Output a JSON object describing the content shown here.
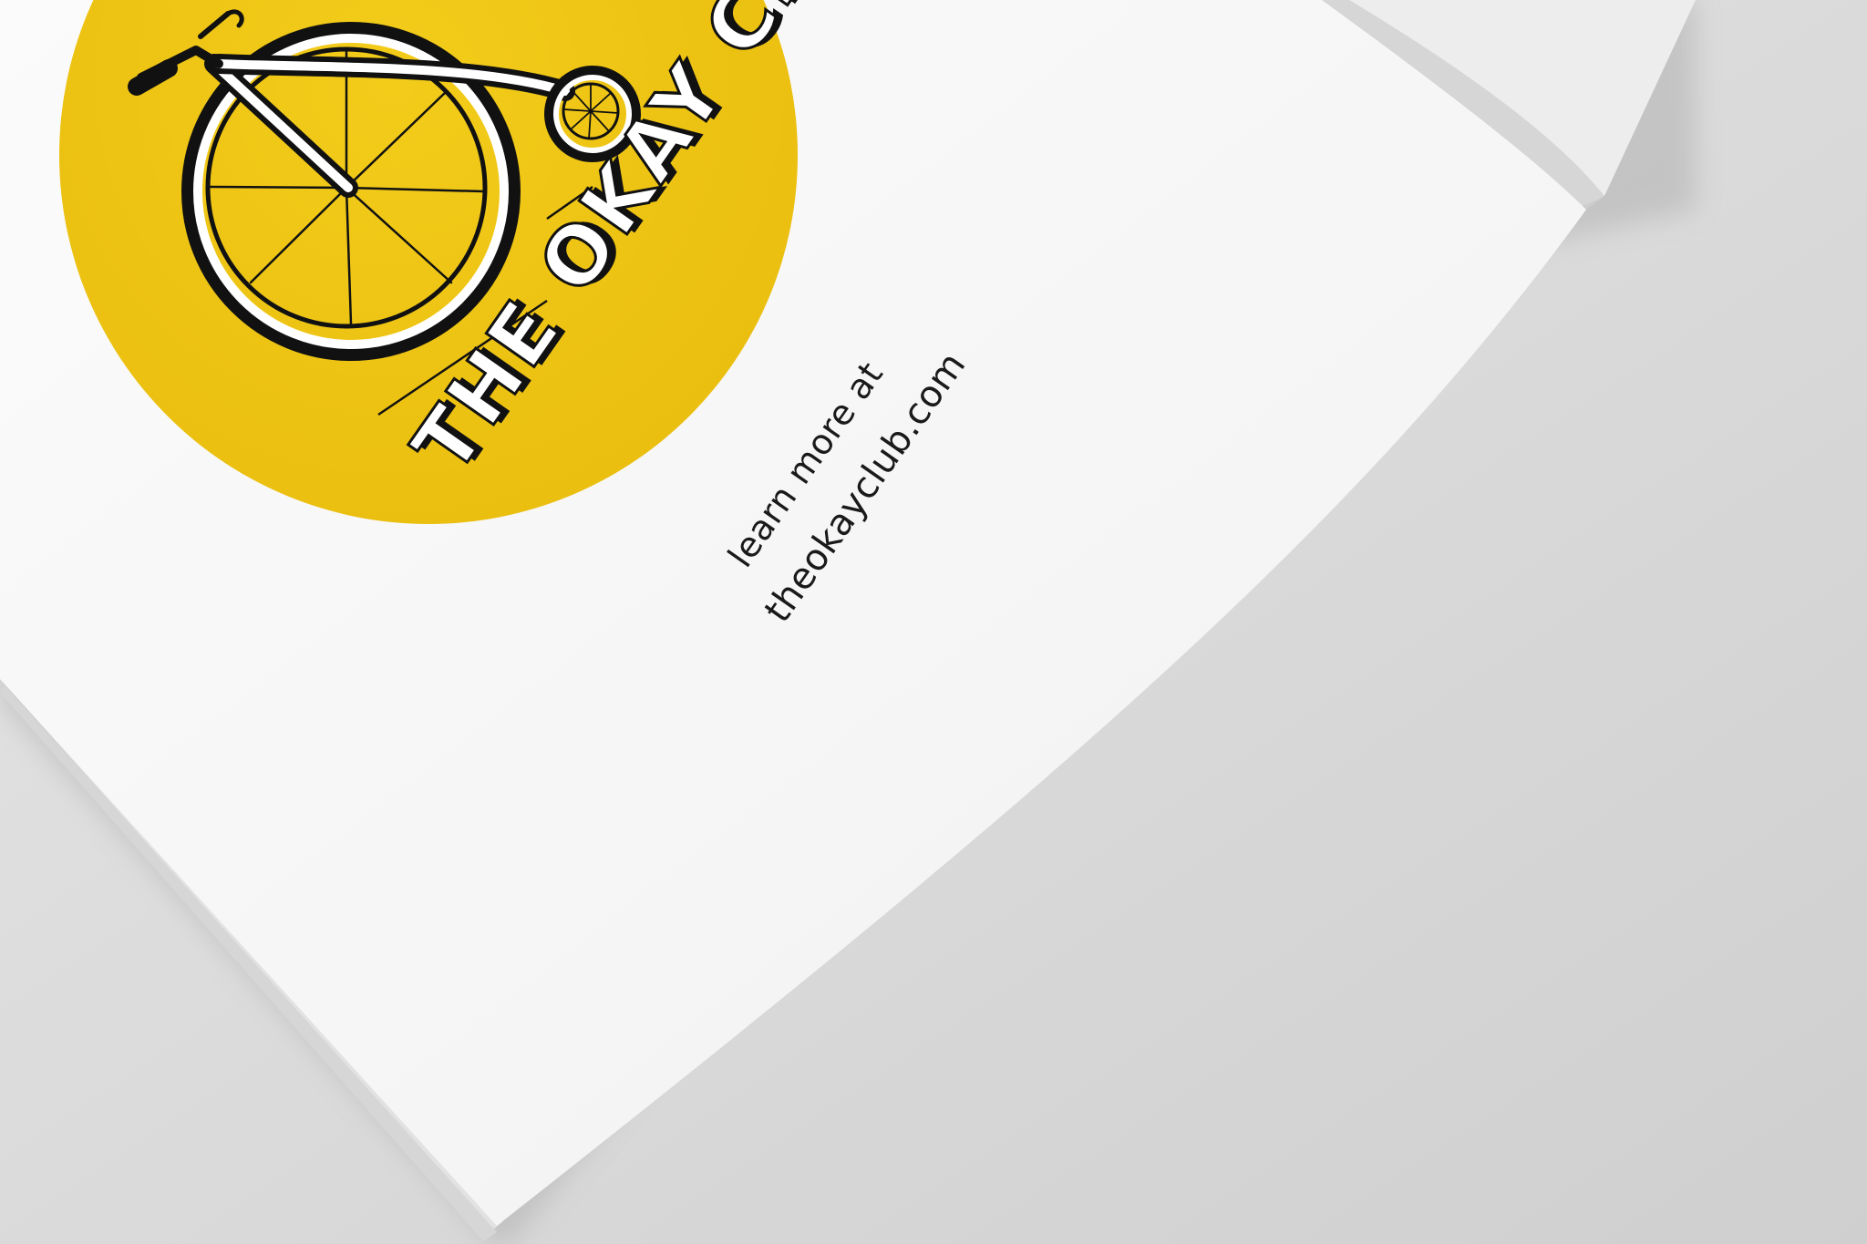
{
  "scene": {
    "description_free": true,
    "colors": {
      "background": "#dcdcdc",
      "page": "#f7f7f7",
      "logo_circle": "#f0c614",
      "ink": "#111111"
    }
  },
  "logo": {
    "text": "THE OKAY CLUB"
  },
  "caption": {
    "line1": "learn more at",
    "line2": "theokayclub.com"
  }
}
